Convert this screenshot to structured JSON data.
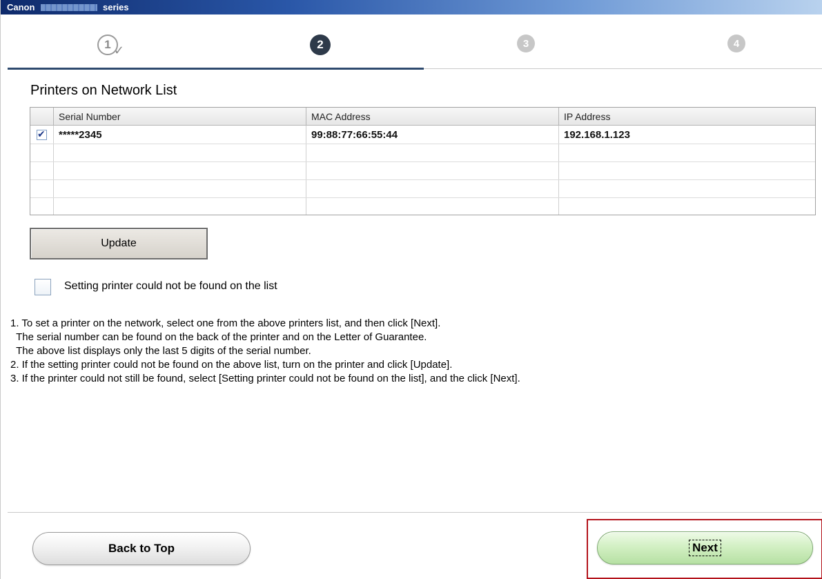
{
  "window": {
    "title_brand": "Canon",
    "title_series": "series"
  },
  "steps": [
    {
      "number": "1",
      "state": "completed"
    },
    {
      "number": "2",
      "state": "current"
    },
    {
      "number": "3",
      "state": "upcoming"
    },
    {
      "number": "4",
      "state": "upcoming"
    }
  ],
  "page": {
    "heading": "Printers on Network List"
  },
  "printer_list": {
    "columns": [
      "Serial Number",
      "MAC Address",
      "IP Address"
    ],
    "rows": [
      {
        "checked": true,
        "serial": "*****2345",
        "mac": "99:88:77:66:55:44",
        "ip": "192.168.1.123"
      }
    ]
  },
  "buttons": {
    "update": "Update",
    "back_to_top": "Back to Top",
    "next": "Next"
  },
  "not_found_option": {
    "label": "Setting printer could not be found on the list",
    "checked": false
  },
  "instructions": [
    "1. To set a printer on the network, select one from the above printers list, and then click [Next].",
    "  The serial number can be found on the back of the printer and on the Letter of Guarantee.",
    "  The above list displays only the last 5 digits of the serial number.",
    "2. If the setting printer could not be found on the above list, turn on the printer and click [Update].",
    "3. If the printer could not still be found, select [Setting printer could not be found on the list], and the click [Next]."
  ],
  "colors": {
    "current_step": "#2e3a4a",
    "next_button": "#c9ebb8",
    "highlight_frame": "#b3121a"
  }
}
